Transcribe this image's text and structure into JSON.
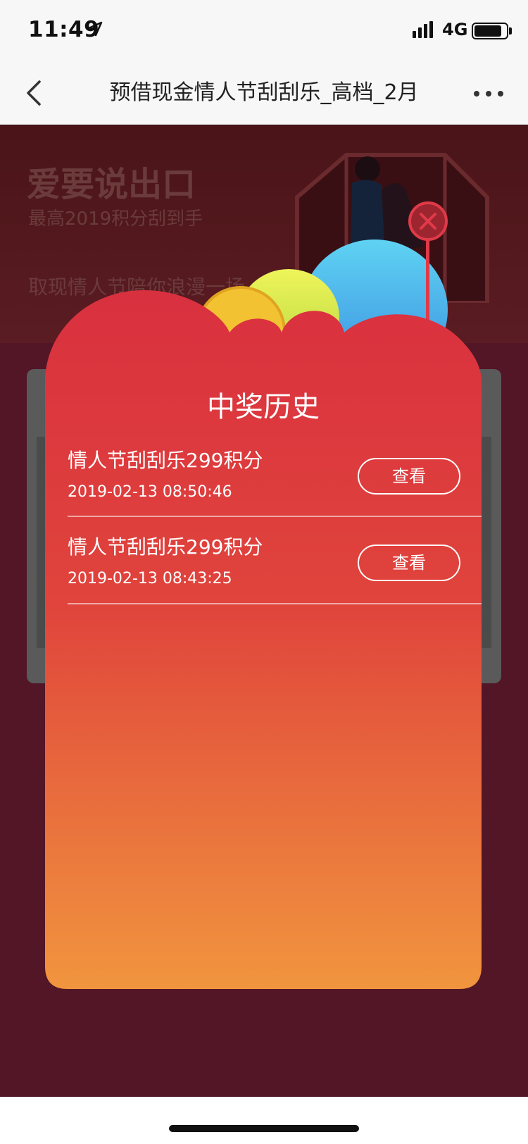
{
  "status_bar": {
    "time": "11:49",
    "network": "4G"
  },
  "nav": {
    "title": "预借现金情人节刮刮乐_高档_2月"
  },
  "banner": {
    "headline": "爱要说出口",
    "subline": "最高2019积分刮到手",
    "tagline": "取现情人节陪你浪漫一场"
  },
  "modal": {
    "title": "中奖历史",
    "records": [
      {
        "title": "情人节刮刮乐299积分",
        "time": "2019-02-13 08:50:46",
        "action": "查看"
      },
      {
        "title": "情人节刮刮乐299积分",
        "time": "2019-02-13 08:43:25",
        "action": "查看"
      }
    ]
  },
  "colors": {
    "modal_top": "#d9303f",
    "modal_bottom": "#f1953e",
    "page_bg": "#521626",
    "close_accent": "#e03a48"
  },
  "icons": [
    "location-arrow-icon",
    "signal-icon",
    "battery-icon",
    "back-chevron-icon",
    "more-dots-icon",
    "close-icon"
  ]
}
